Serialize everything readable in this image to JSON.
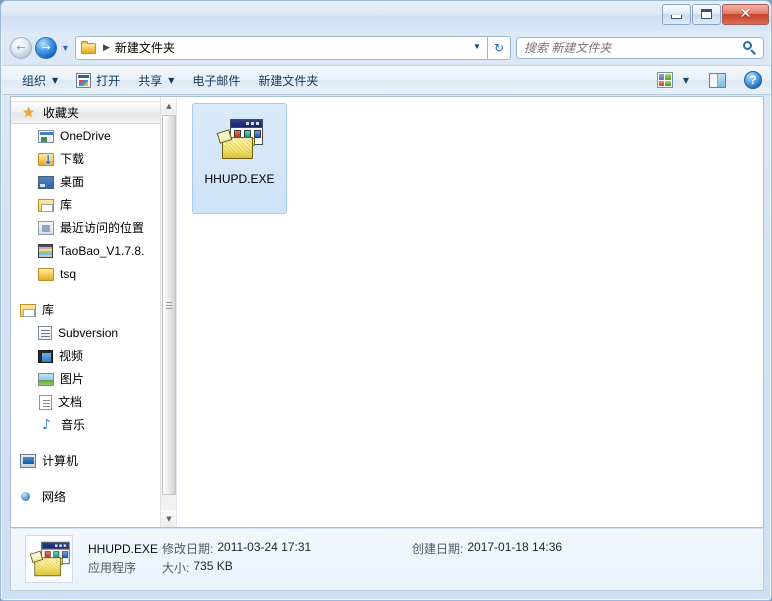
{
  "window": {
    "title": "",
    "controls": {
      "minimize": "minimize",
      "maximize": "maximize",
      "close": "close"
    }
  },
  "addressbar": {
    "back_tooltip": "后退",
    "forward_tooltip": "前进",
    "recent_dropdown": "▼",
    "folder_icon": "folder-icon",
    "separator": "▶",
    "path": "新建文件夹",
    "dropdown": "▼",
    "refresh": "↻"
  },
  "search": {
    "placeholder": "搜索 新建文件夹",
    "icon": "search-icon"
  },
  "toolbar": {
    "items": [
      {
        "label": "组织",
        "has_caret": true,
        "icon": null
      },
      {
        "label": "打开",
        "has_caret": false,
        "icon": "open-icon"
      },
      {
        "label": "共享",
        "has_caret": true,
        "icon": null
      },
      {
        "label": "电子邮件",
        "has_caret": false,
        "icon": null
      },
      {
        "label": "新建文件夹",
        "has_caret": false,
        "icon": null
      }
    ],
    "right": {
      "views_icon": "views-icon",
      "views_caret": "▼",
      "preview_pane_icon": "preview-pane-icon",
      "help_icon": "help-icon",
      "help_glyph": "?"
    }
  },
  "navpane": {
    "groups": [
      {
        "header": {
          "label": "收藏夹",
          "icon": "star-icon"
        },
        "items": [
          {
            "label": "OneDrive",
            "icon": "onedrive-icon"
          },
          {
            "label": "下载",
            "icon": "downloads-folder-icon"
          },
          {
            "label": "桌面",
            "icon": "desktop-icon"
          },
          {
            "label": "库",
            "icon": "library-icon"
          },
          {
            "label": "最近访问的位置",
            "icon": "recent-places-icon"
          },
          {
            "label": "TaoBao_V1.7.8.",
            "icon": "archive-icon"
          },
          {
            "label": "tsq",
            "icon": "folder-icon"
          }
        ]
      },
      {
        "header": {
          "label": "库",
          "icon": "library-icon"
        },
        "items": [
          {
            "label": "Subversion",
            "icon": "subversion-icon"
          },
          {
            "label": "视频",
            "icon": "video-library-icon"
          },
          {
            "label": "图片",
            "icon": "pictures-library-icon"
          },
          {
            "label": "文档",
            "icon": "documents-library-icon"
          },
          {
            "label": "音乐",
            "icon": "music-library-icon"
          }
        ]
      },
      {
        "header": {
          "label": "计算机",
          "icon": "computer-icon"
        },
        "items": []
      },
      {
        "header": {
          "label": "网络",
          "icon": "network-icon"
        },
        "items": []
      }
    ],
    "scrollbar": {
      "up_arrow": "▲",
      "down_arrow": "▼"
    }
  },
  "content": {
    "files": [
      {
        "name": "HHUPD.EXE",
        "icon": "application-setup-icon",
        "selected": true
      }
    ]
  },
  "details": {
    "file_name": "HHUPD.EXE",
    "file_type": "应用程序",
    "modified_label": "修改日期:",
    "modified_value": "2011-03-24 17:31",
    "created_label": "创建日期:",
    "created_value": "2017-01-18 14:36",
    "size_label": "大小:",
    "size_value": "735 KB",
    "icon": "application-setup-icon"
  },
  "colors": {
    "titlebar_top": "#e9f1fa",
    "frame": "#cfdff2",
    "selection_fill": "#cfe3f7",
    "selection_border": "#a6caea",
    "close_button": "#c8432c",
    "accent_blue": "#1e6bb8"
  }
}
